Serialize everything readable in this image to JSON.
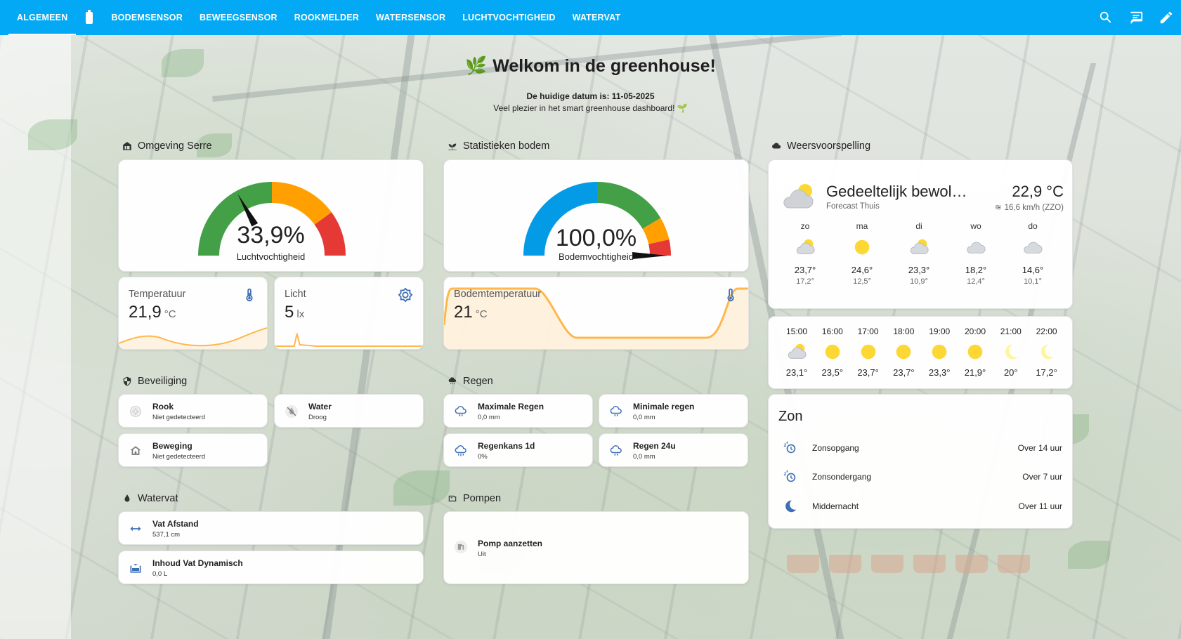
{
  "tabs": [
    {
      "label": "ALGEMEEN",
      "active": true
    },
    {
      "label": "",
      "icon": "battery-icon"
    },
    {
      "label": "BODEMSENSOR"
    },
    {
      "label": "BEWEEGSENSOR"
    },
    {
      "label": "ROOKMELDER"
    },
    {
      "label": "WATERSENSOR"
    },
    {
      "label": "LUCHTVOCHTIGHEID"
    },
    {
      "label": "WATERVAT"
    }
  ],
  "toolbar_icons": [
    "search-icon",
    "chat-icon",
    "pencil-icon"
  ],
  "welcome": {
    "title": "Welkom in de greenhouse!",
    "date_line": "De huidige datum is: 11-05-2025",
    "sub_line": "Veel plezier in het smart greenhouse dashboard! 🌱"
  },
  "sections": {
    "omgeving": "Omgeving Serre",
    "bodem": "Statistieken bodem",
    "weer": "Weersvoorspelling",
    "beveiliging": "Beveiliging",
    "regen": "Regen",
    "watervat": "Watervat",
    "pompen": "Pompen"
  },
  "gauges": {
    "lucht": {
      "value_text": "33,9%",
      "value": 33.9,
      "label": "Luchtvochtigheid"
    },
    "bodem": {
      "value_text": "100,0%",
      "value": 100.0,
      "label": "Bodemvochtigheid"
    }
  },
  "sensors": {
    "temperatuur": {
      "name": "Temperatuur",
      "value": "21,9",
      "unit": "°C"
    },
    "licht": {
      "name": "Licht",
      "value": "5",
      "unit": "lx"
    },
    "bodemtemp": {
      "name": "Bodemtemperatuur",
      "value": "21",
      "unit": "°C"
    }
  },
  "security": {
    "rook": {
      "name": "Rook",
      "state": "Niet gedetecteerd"
    },
    "water": {
      "name": "Water",
      "state": "Droog"
    },
    "beweging": {
      "name": "Beweging",
      "state": "Niet gedetecteerd"
    }
  },
  "rain": {
    "max": {
      "name": "Maximale Regen",
      "state": "0,0 mm"
    },
    "min": {
      "name": "Minimale regen",
      "state": "0,0 mm"
    },
    "kans": {
      "name": "Regenkans 1d",
      "state": "0%"
    },
    "r24": {
      "name": "Regen 24u",
      "state": "0,0 mm"
    }
  },
  "tank": {
    "afstand": {
      "name": "Vat Afstand",
      "state": "537,1 cm"
    },
    "inhoud": {
      "name": "Inhoud Vat Dynamisch",
      "state": "0,0 L"
    }
  },
  "pump": {
    "name": "Pomp aanzetten",
    "state": "Uit"
  },
  "weather": {
    "condition": "Gedeeltelijk bewol…",
    "source": "Forecast Thuis",
    "temp": "22,9 °C",
    "wind": "16,6 km/h (ZZO)",
    "daily": [
      {
        "day": "zo",
        "hi": "23,7°",
        "lo": "17,2°",
        "icon": "partly-cloudy-icon"
      },
      {
        "day": "ma",
        "hi": "24,6°",
        "lo": "12,5°",
        "icon": "sunny-icon"
      },
      {
        "day": "di",
        "hi": "23,3°",
        "lo": "10,9°",
        "icon": "partly-cloudy-icon"
      },
      {
        "day": "wo",
        "hi": "18,2°",
        "lo": "12,4°",
        "icon": "cloudy-icon"
      },
      {
        "day": "do",
        "hi": "14,6°",
        "lo": "10,1°",
        "icon": "cloudy-icon"
      }
    ],
    "hourly": [
      {
        "time": "15:00",
        "temp": "23,1°",
        "icon": "partly-cloudy-icon"
      },
      {
        "time": "16:00",
        "temp": "23,5°",
        "icon": "sunny-icon"
      },
      {
        "time": "17:00",
        "temp": "23,7°",
        "icon": "sunny-icon"
      },
      {
        "time": "18:00",
        "temp": "23,7°",
        "icon": "sunny-icon"
      },
      {
        "time": "19:00",
        "temp": "23,3°",
        "icon": "sunny-icon"
      },
      {
        "time": "20:00",
        "temp": "21,9°",
        "icon": "sunny-icon"
      },
      {
        "time": "21:00",
        "temp": "20°",
        "icon": "moon-icon"
      },
      {
        "time": "22:00",
        "temp": "17,2°",
        "icon": "moon-icon"
      }
    ]
  },
  "sun": {
    "title": "Zon",
    "rows": [
      {
        "name": "Zonsopgang",
        "value": "Over 14 uur",
        "icon": "sunrise-clock-icon"
      },
      {
        "name": "Zonsondergang",
        "value": "Over 7 uur",
        "icon": "sunset-clock-icon"
      },
      {
        "name": "Middernacht",
        "value": "Over 11 uur",
        "icon": "moon-icon"
      }
    ]
  },
  "colors": {
    "accent": "#03a9f4",
    "gauge_green": "#43a047",
    "gauge_orange": "#ffa000",
    "gauge_red": "#e53935",
    "gauge_blue": "#039be5",
    "spark": "#ffb74d",
    "sun": "#fdd835"
  }
}
